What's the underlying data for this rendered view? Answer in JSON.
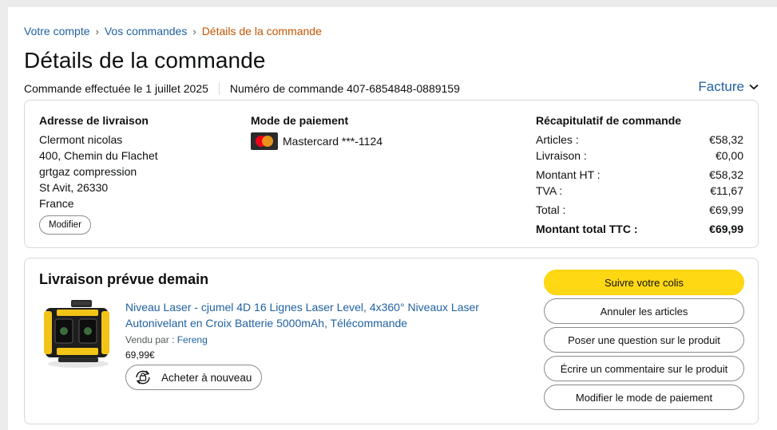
{
  "breadcrumb": {
    "account": "Votre compte",
    "orders": "Vos commandes",
    "current": "Détails de la commande",
    "separator": "›"
  },
  "page_title": "Détails de la commande",
  "order": {
    "placed_label": "Commande effectuée le 1 juillet 2025",
    "number_label": "Numéro de commande 407-6854848-0889159"
  },
  "invoice_label": "Facture",
  "address": {
    "title": "Adresse de livraison",
    "lines": [
      "Clermont nicolas",
      "400, Chemin du Flachet",
      "grtgaz compression",
      "St Avit, 26330",
      "France"
    ],
    "edit_label": "Modifier"
  },
  "payment": {
    "title": "Mode de paiement",
    "card_label": "Mastercard ***-1124",
    "card_icon": "mastercard-icon"
  },
  "summary": {
    "title": "Récapitulatif de commande",
    "rows": [
      {
        "label": "Articles :",
        "value": "€58,32"
      },
      {
        "label": "Livraison :",
        "value": "€0,00"
      },
      {
        "label": "Montant HT :",
        "value": "€58,32"
      },
      {
        "label": "TVA :",
        "value": "€11,67"
      },
      {
        "label": "Total :",
        "value": "€69,99"
      },
      {
        "label": "Montant total TTC :",
        "value": "€69,99"
      }
    ]
  },
  "shipment": {
    "title": "Livraison prévue demain",
    "product_title": "Niveau Laser - cjumel 4D 16 Lignes Laser Level, 4x360° Niveaux Laser Autonivelant en Croix Batterie 5000mAh, Télécommande",
    "seller_label": "Vendu par",
    "seller_name": ": Fereng",
    "price": "69,99€",
    "rebuy_label": "Acheter à nouveau"
  },
  "actions": {
    "track": "Suivre votre colis",
    "cancel": "Annuler les articles",
    "question": "Poser une question sur le produit",
    "review": "Écrire un commentaire sur le produit",
    "change_payment": "Modifier le mode de paiement"
  },
  "colors": {
    "link": "#2162a1",
    "current_crumb": "#c45500",
    "primary_button": "#ffd814"
  }
}
